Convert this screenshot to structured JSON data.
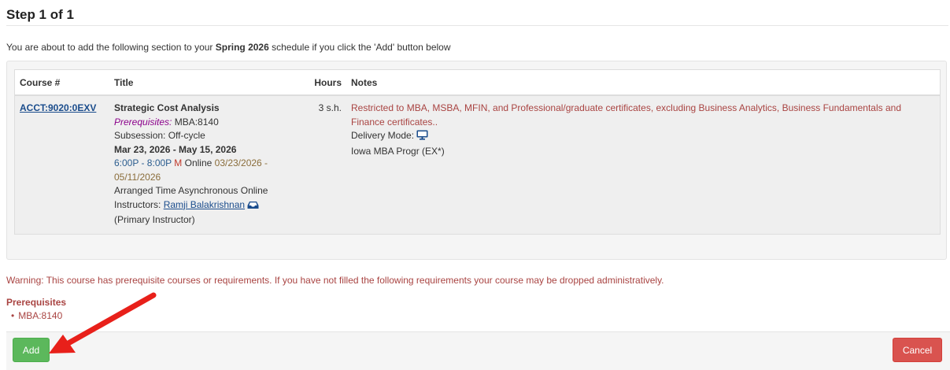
{
  "page": {
    "heading": "Step 1 of 1",
    "intro_before": "You are about to add the following section to your ",
    "intro_term": "Spring 2026",
    "intro_after": " schedule if you click the 'Add' button below"
  },
  "table": {
    "headers": {
      "course": "Course #",
      "title": "Title",
      "hours": "Hours",
      "notes": "Notes"
    },
    "row": {
      "course_number": "ACCT:9020:0EXV",
      "title": "Strategic Cost Analysis",
      "prereq_label": "Prerequisites:",
      "prereq_value": " MBA:8140",
      "subsession": "Subsession: Off-cycle",
      "dates": "Mar 23, 2026 - May 15, 2026",
      "time": "6:00P - 8:00P",
      "day": "M",
      "location": " Online ",
      "range_start": "03/23/2026 -",
      "range_end": "05/11/2026",
      "arranged": "Arranged Time Asynchronous Online",
      "instructors_label": "Instructors: ",
      "instructor_name": "Ramji Balakrishnan",
      "instructor_role": "(Primary Instructor)",
      "hours": "3 s.h.",
      "note_restriction": "Restricted to MBA, MSBA, MFIN, and Professional/graduate certificates, excluding Business Analytics, Business Fundamentals and Finance certificates..",
      "delivery_label": "Delivery Mode: ",
      "program": "Iowa MBA Progr (EX*)"
    }
  },
  "warning": {
    "text": "Warning: This course has prerequisite courses or requirements. If you have not filled the following requirements your course may be dropped administratively.",
    "prereq_heading": "Prerequisites",
    "prereq_items": [
      "MBA:8140"
    ]
  },
  "buttons": {
    "add": "Add",
    "cancel": "Cancel"
  },
  "colors": {
    "add": "#5cb85c",
    "cancel": "#d9534f",
    "warning": "#a94442",
    "arrow": "#e8201a"
  },
  "icons": {
    "delivery": "monitor-icon",
    "email": "inbox-icon",
    "pointer": "red-arrow"
  }
}
